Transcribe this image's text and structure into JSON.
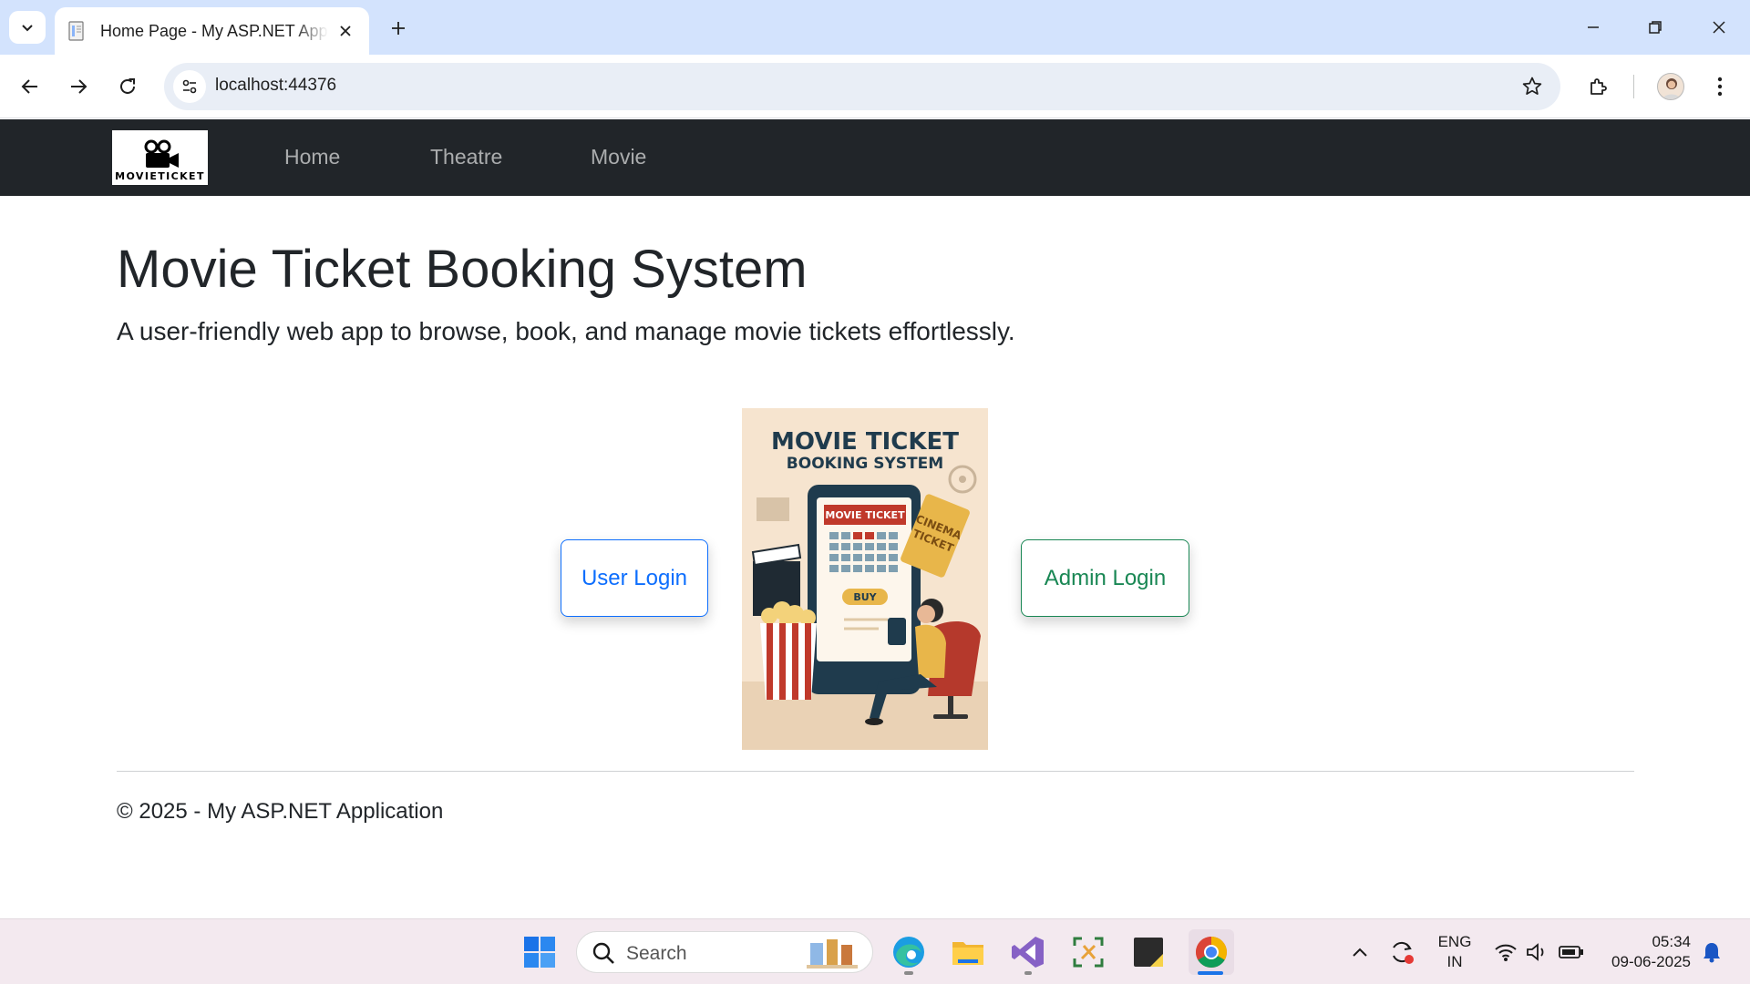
{
  "browser": {
    "tab_title": "Home Page - My ASP.NET Application",
    "url": "localhost:44376"
  },
  "navbar": {
    "brand_text": "MOVIETICKET",
    "links": [
      "Home",
      "Theatre",
      "Movie"
    ]
  },
  "hero": {
    "title": "Movie Ticket Booking System",
    "lead": "A user-friendly web app to browse, book, and manage movie tickets effortlessly."
  },
  "actions": {
    "user_login": "User Login",
    "admin_login": "Admin Login"
  },
  "poster": {
    "line1": "MOVIE TICKET",
    "line2": "BOOKING SYSTEM",
    "screen_label": "MOVIE TICKET",
    "buy": "BUY",
    "ticket_line1": "CINEMA",
    "ticket_line2": "TICKET"
  },
  "footer": {
    "text": "© 2025 - My ASP.NET Application"
  },
  "taskbar": {
    "search_placeholder": "Search",
    "lang_line1": "ENG",
    "lang_line2": "IN",
    "time": "05:34",
    "date": "09-06-2025"
  },
  "colors": {
    "navbar_bg": "#212529",
    "primary": "#0d6efd",
    "success": "#198754",
    "tabstrip_bg": "#d3e3fd"
  }
}
